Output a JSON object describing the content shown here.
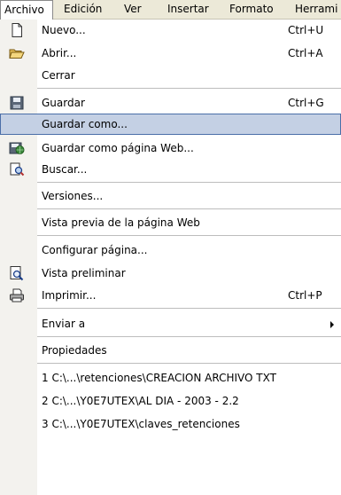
{
  "menubar": {
    "items": [
      {
        "label": "Archivo"
      },
      {
        "label": "Edición"
      },
      {
        "label": "Ver"
      },
      {
        "label": "Insertar"
      },
      {
        "label": "Formato"
      },
      {
        "label": "Herrami"
      }
    ]
  },
  "menu": {
    "items": [
      {
        "label": "Nuevo...",
        "shortcut": "Ctrl+U",
        "icon": "new-document-icon"
      },
      {
        "label": "Abrir...",
        "shortcut": "Ctrl+A",
        "icon": "open-folder-icon"
      },
      {
        "label": "Cerrar"
      },
      {
        "label": "Guardar",
        "shortcut": "Ctrl+G",
        "icon": "save-disk-icon"
      },
      {
        "label": "Guardar como..."
      },
      {
        "label": "Guardar como página Web...",
        "icon": "save-web-icon"
      },
      {
        "label": "Buscar...",
        "icon": "search-document-icon"
      },
      {
        "label": "Versiones..."
      },
      {
        "label": "Vista previa de la página Web"
      },
      {
        "label": "Configurar página..."
      },
      {
        "label": "Vista preliminar",
        "icon": "print-preview-icon"
      },
      {
        "label": "Imprimir...",
        "shortcut": "Ctrl+P",
        "icon": "printer-icon"
      },
      {
        "label": "Enviar a"
      },
      {
        "label": "Propiedades"
      },
      {
        "label": "1 C:\\...\\retenciones\\CREACION ARCHIVO TXT"
      },
      {
        "label": "2 C:\\...\\Y0E7UTEX\\AL DIA - 2003 - 2.2"
      },
      {
        "label": "3 C:\\...\\Y0E7UTEX\\claves_retenciones"
      }
    ]
  },
  "colors": {
    "highlight_fill": "#c4d0e4",
    "highlight_border": "#4b6fa8",
    "menubar_bg": "#ece9d8"
  }
}
